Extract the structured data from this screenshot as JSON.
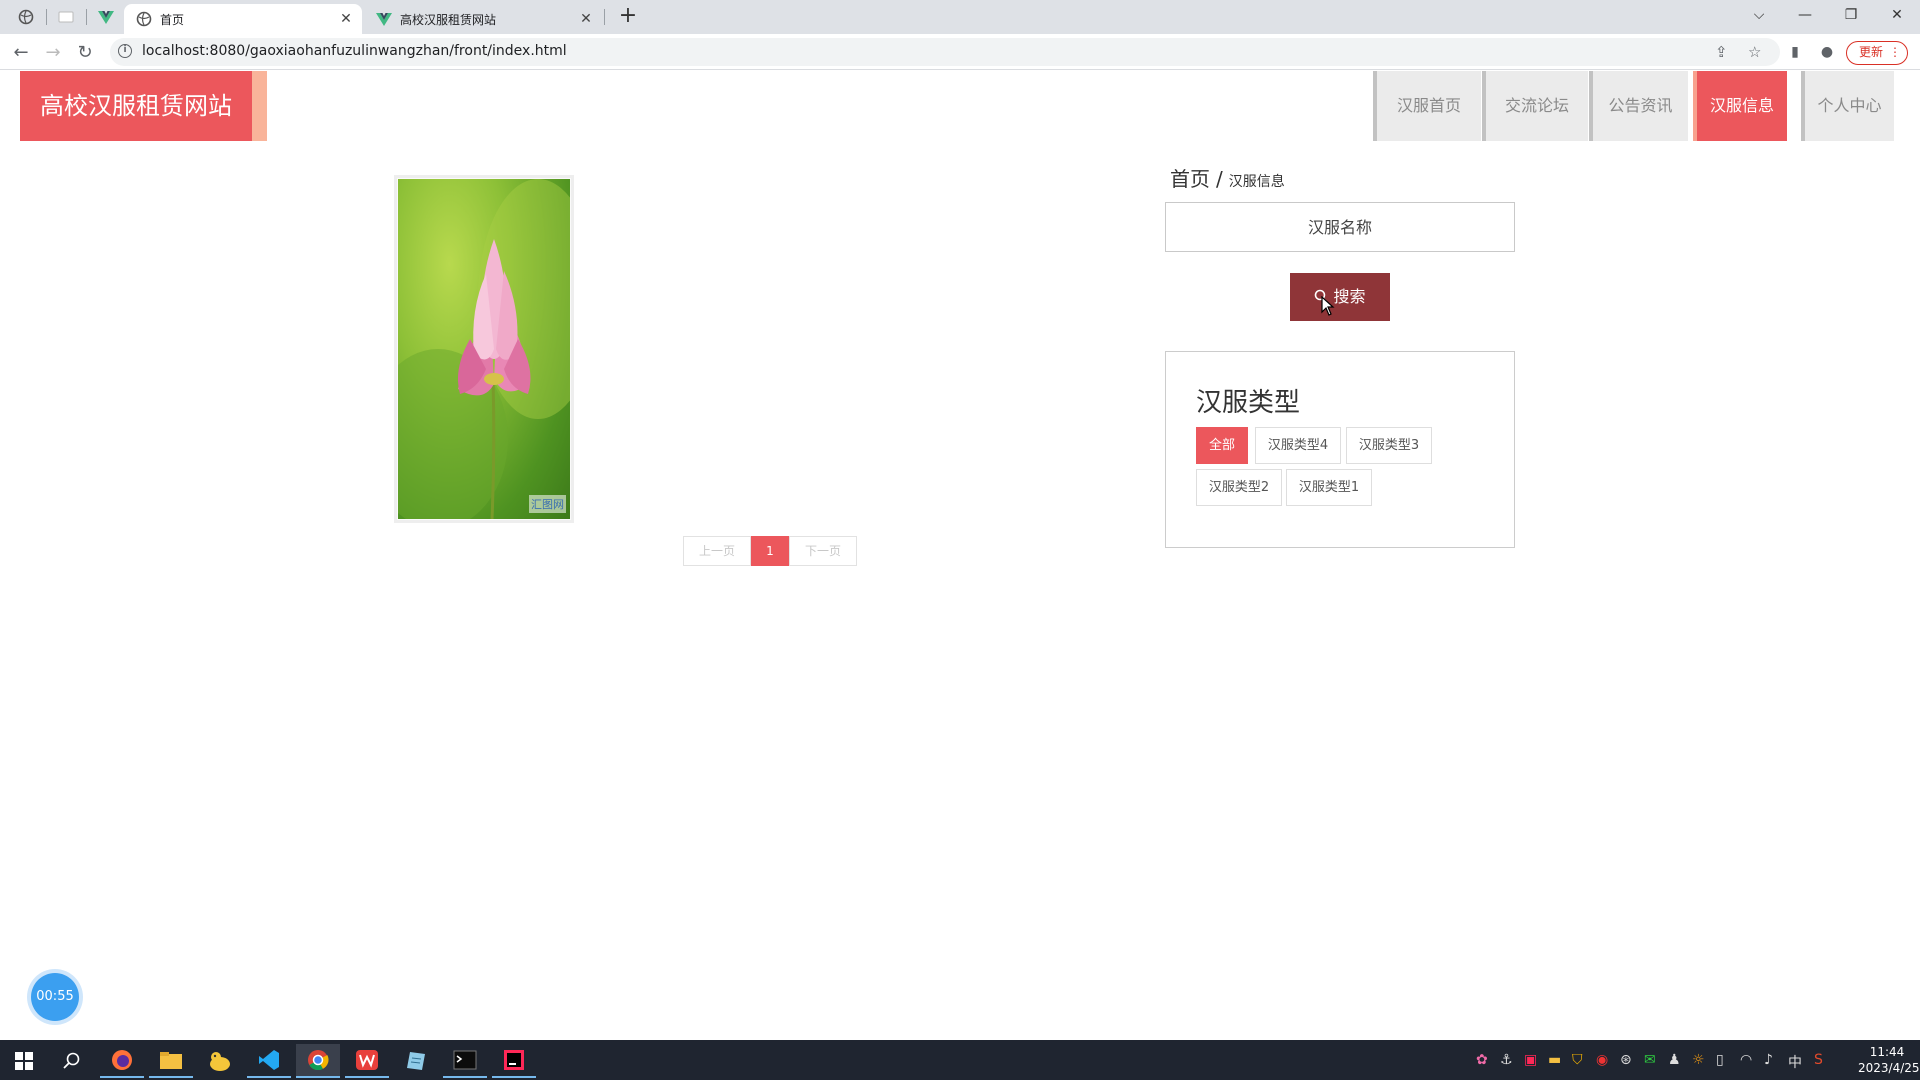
{
  "browser": {
    "tabs": [
      {
        "title": "首页",
        "favicon": "globe-icon",
        "active": true
      },
      {
        "title": "高校汉服租赁网站",
        "favicon": "vue-icon",
        "active": false
      }
    ],
    "url": "localhost:8080/gaoxiaohanfuzulinwangzhan/front/index.html",
    "update_label": "更新"
  },
  "site": {
    "logo_text": "高校汉服租赁网站",
    "nav": [
      "汉服首页",
      "交流论坛",
      "公告资讯",
      "汉服信息",
      "个人中心"
    ],
    "active_nav": "汉服信息",
    "accent_color": "#ec575c"
  },
  "breadcrumb": {
    "home": "首页",
    "separator": "/",
    "current": "汉服信息"
  },
  "search": {
    "placeholder": "汉服名称",
    "button_label": "搜索"
  },
  "types": {
    "title": "汉服类型",
    "chips": [
      "全部",
      "汉服类型4",
      "汉服类型3",
      "汉服类型2",
      "汉服类型1"
    ],
    "selected": "全部"
  },
  "product": {
    "watermark": "汇图网"
  },
  "pagination": {
    "prev": "上一页",
    "current": "1",
    "next": "下一页"
  },
  "timer": "00:55",
  "taskbar": {
    "time": "11:44",
    "date": "2023/4/25",
    "ime": "中"
  }
}
